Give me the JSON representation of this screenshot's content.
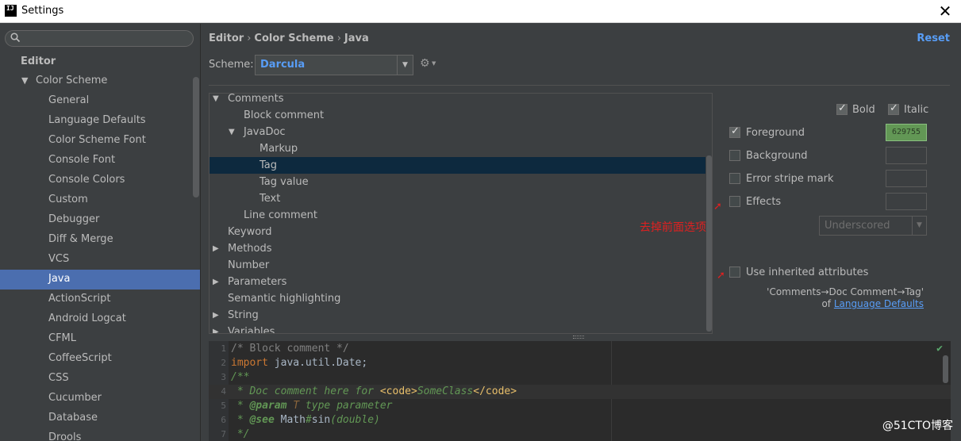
{
  "window": {
    "app_icon": "IJ",
    "title": "Settings",
    "close_glyph": "✕"
  },
  "sidebar": {
    "search_placeholder": "",
    "section": "Editor",
    "group": {
      "label": "Color Scheme",
      "caret": "▼"
    },
    "items": [
      {
        "label": "General",
        "selected": false
      },
      {
        "label": "Language Defaults",
        "selected": false
      },
      {
        "label": "Color Scheme Font",
        "selected": false
      },
      {
        "label": "Console Font",
        "selected": false
      },
      {
        "label": "Console Colors",
        "selected": false
      },
      {
        "label": "Custom",
        "selected": false
      },
      {
        "label": "Debugger",
        "selected": false
      },
      {
        "label": "Diff & Merge",
        "selected": false
      },
      {
        "label": "VCS",
        "selected": false
      },
      {
        "label": "Java",
        "selected": true
      },
      {
        "label": "ActionScript",
        "selected": false
      },
      {
        "label": "Android Logcat",
        "selected": false
      },
      {
        "label": "CFML",
        "selected": false
      },
      {
        "label": "CoffeeScript",
        "selected": false
      },
      {
        "label": "CSS",
        "selected": false
      },
      {
        "label": "Cucumber",
        "selected": false
      },
      {
        "label": "Database",
        "selected": false
      },
      {
        "label": "Drools",
        "selected": false
      }
    ]
  },
  "header": {
    "breadcrumb": [
      "Editor",
      "Color Scheme",
      "Java"
    ],
    "separator": "›",
    "reset_label": "Reset"
  },
  "scheme": {
    "label": "Scheme:",
    "value": "Darcula",
    "arrow": "▼",
    "gear_glyph": "⚙",
    "gear_arrow": "▼"
  },
  "attributes": [
    {
      "label": "Comments",
      "indent": 1,
      "expander": "▼",
      "selected": false
    },
    {
      "label": "Block comment",
      "indent": 2,
      "expander": "",
      "selected": false
    },
    {
      "label": "JavaDoc",
      "indent": 2,
      "expander": "▼",
      "selected": false
    },
    {
      "label": "Markup",
      "indent": 3,
      "expander": "",
      "selected": false
    },
    {
      "label": "Tag",
      "indent": 3,
      "expander": "",
      "selected": true
    },
    {
      "label": "Tag value",
      "indent": 3,
      "expander": "",
      "selected": false
    },
    {
      "label": "Text",
      "indent": 3,
      "expander": "",
      "selected": false
    },
    {
      "label": "Line comment",
      "indent": 2,
      "expander": "",
      "selected": false
    },
    {
      "label": "Keyword",
      "indent": 1,
      "expander": "",
      "selected": false
    },
    {
      "label": "Methods",
      "indent": 1,
      "expander": "▶",
      "selected": false
    },
    {
      "label": "Number",
      "indent": 1,
      "expander": "",
      "selected": false
    },
    {
      "label": "Parameters",
      "indent": 1,
      "expander": "▶",
      "selected": false
    },
    {
      "label": "Semantic highlighting",
      "indent": 1,
      "expander": "",
      "selected": false
    },
    {
      "label": "String",
      "indent": 1,
      "expander": "▶",
      "selected": false
    },
    {
      "label": "Variables",
      "indent": 1,
      "expander": "▶",
      "selected": false
    }
  ],
  "panel": {
    "bold": {
      "label": "Bold",
      "checked": true
    },
    "italic": {
      "label": "Italic",
      "checked": true
    },
    "foreground": {
      "label": "Foreground",
      "checked": true,
      "color": "629755"
    },
    "background": {
      "label": "Background",
      "checked": false
    },
    "error_stripe": {
      "label": "Error stripe mark",
      "checked": false
    },
    "effects": {
      "label": "Effects",
      "checked": false,
      "type": "Underscored",
      "arrow": "▼"
    },
    "inherited": {
      "label": "Use inherited attributes",
      "checked": false
    },
    "inherit_path": "'Comments→Doc Comment→Tag'",
    "inherit_of": "of",
    "inherit_link": "Language Defaults"
  },
  "annotation": {
    "text": "去掉前面选项",
    "arrow": "➚"
  },
  "colors": {
    "accent": "#589df6",
    "selection_sidebar": "#4b6eaf",
    "selection_tree": "#0d293e",
    "doc_green": "#629755",
    "annotation_red": "#e02020"
  },
  "editor": {
    "check_glyph": "✔",
    "lines": [
      {
        "n": "1",
        "parts": [
          {
            "t": "/* Block comment */",
            "c": "c-comment"
          }
        ]
      },
      {
        "n": "2",
        "parts": [
          {
            "t": "import",
            "c": "c-kw"
          },
          {
            "t": " java.util.Date;",
            "c": "c-plain"
          }
        ]
      },
      {
        "n": "3",
        "parts": [
          {
            "t": "/**",
            "c": "c-doc"
          }
        ]
      },
      {
        "n": "4",
        "current": true,
        "parts": [
          {
            "t": " * Doc comment here for ",
            "c": "c-doc"
          },
          {
            "t": "<code>",
            "c": "c-html"
          },
          {
            "t": "SomeClass",
            "c": "c-doc"
          },
          {
            "t": "</code>",
            "c": "c-html"
          }
        ]
      },
      {
        "n": "5",
        "parts": [
          {
            "t": " * ",
            "c": "c-doc"
          },
          {
            "t": "@param",
            "c": "c-tag"
          },
          {
            "t": " T",
            "c": "c-tagv"
          },
          {
            "t": " type parameter",
            "c": "c-doc"
          }
        ]
      },
      {
        "n": "6",
        "parts": [
          {
            "t": " * ",
            "c": "c-doc"
          },
          {
            "t": "@see",
            "c": "c-tag"
          },
          {
            "t": " Math",
            "c": "c-param"
          },
          {
            "t": "#",
            "c": "c-doc"
          },
          {
            "t": "sin",
            "c": "c-param"
          },
          {
            "t": "(double)",
            "c": "c-doc"
          }
        ]
      },
      {
        "n": "7",
        "parts": [
          {
            "t": " */",
            "c": "c-doc"
          }
        ]
      }
    ]
  },
  "watermark": "@51CTO博客"
}
